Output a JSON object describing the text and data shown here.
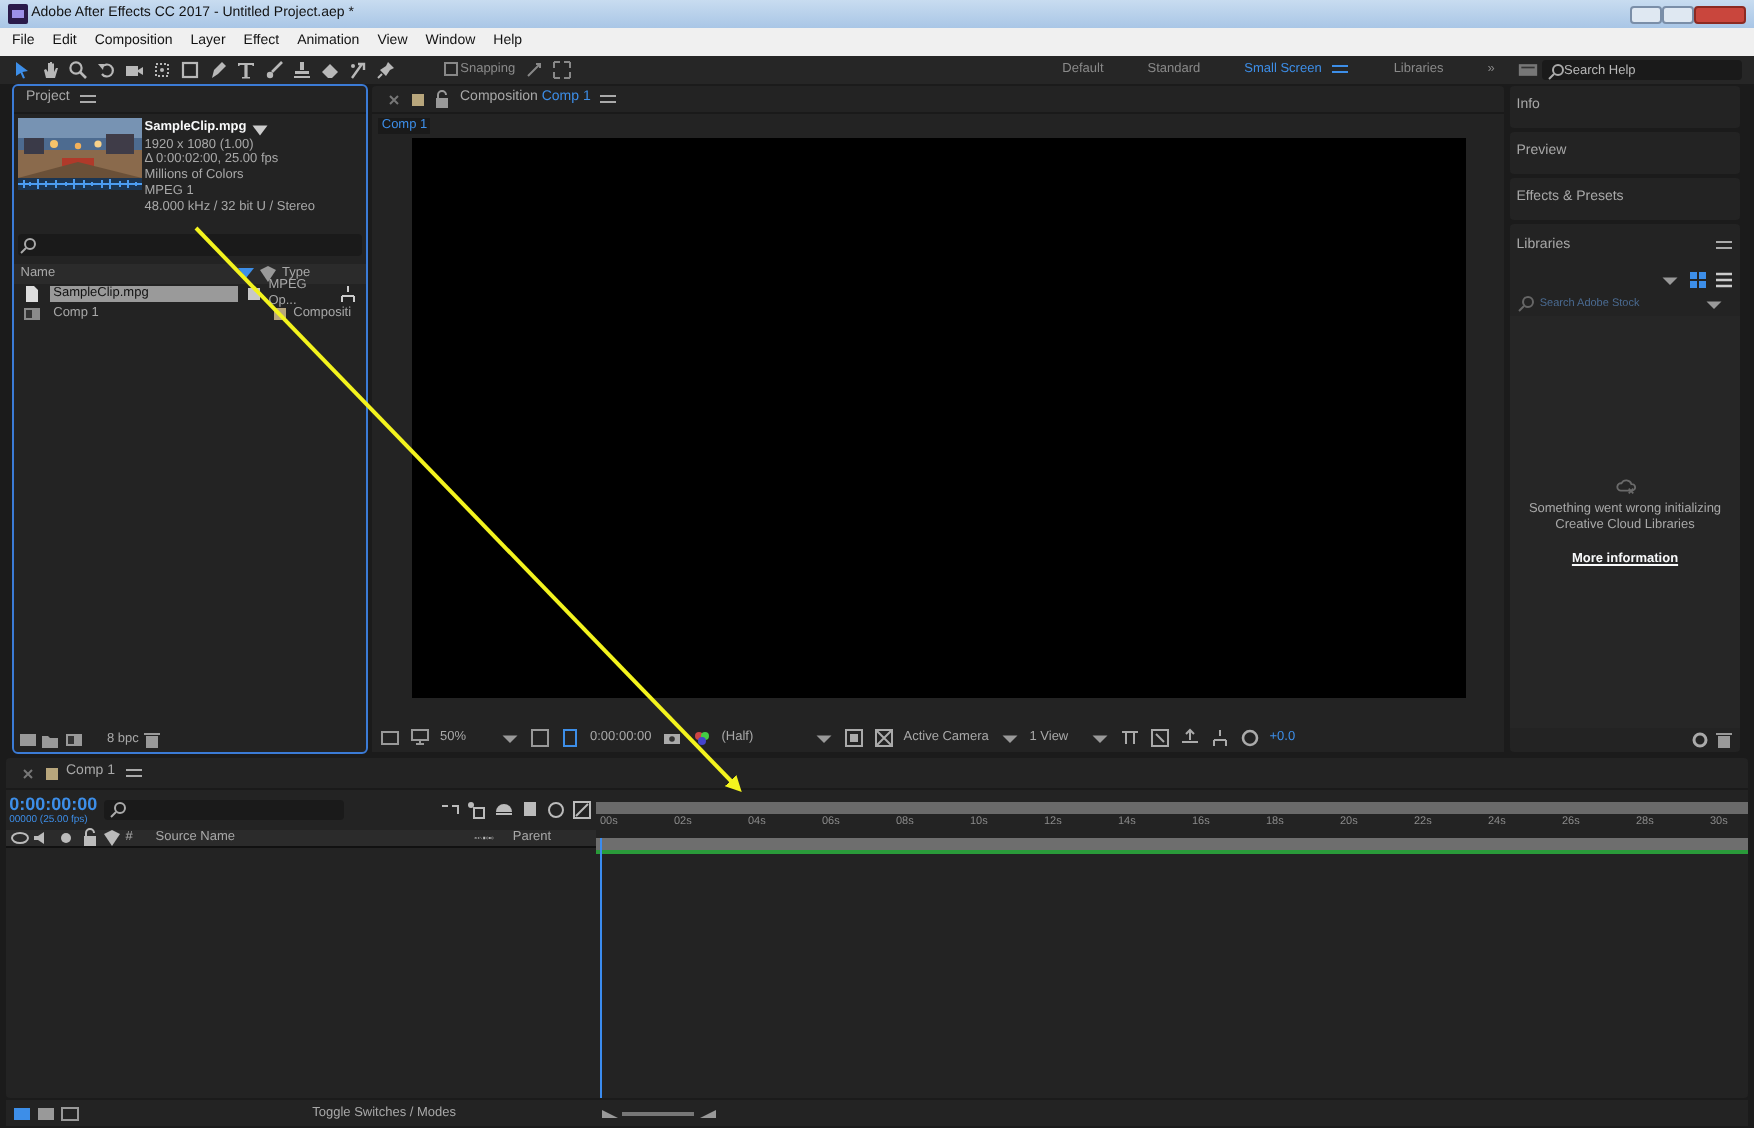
{
  "window": {
    "title": "Adobe After Effects CC 2017 - Untitled Project.aep *"
  },
  "menu": [
    "File",
    "Edit",
    "Composition",
    "Layer",
    "Effect",
    "Animation",
    "View",
    "Window",
    "Help"
  ],
  "tools": [
    {
      "kind": "select",
      "selected": true
    },
    {
      "kind": "hand",
      "selected": false
    },
    {
      "kind": "zoom",
      "selected": false
    },
    {
      "kind": "rotate",
      "selected": false
    },
    {
      "kind": "camera",
      "selected": false
    },
    {
      "kind": "pan",
      "selected": false
    },
    {
      "kind": "rect",
      "selected": false
    },
    {
      "kind": "pen",
      "selected": false
    },
    {
      "kind": "text",
      "selected": false
    },
    {
      "kind": "brush",
      "selected": false
    },
    {
      "kind": "stamp",
      "selected": false
    },
    {
      "kind": "eraser",
      "selected": false
    },
    {
      "kind": "roto",
      "selected": false
    },
    {
      "kind": "pin",
      "selected": false
    }
  ],
  "snapping": {
    "label": "Snapping",
    "checked": false
  },
  "workspaces": [
    {
      "label": "Default",
      "selected": false
    },
    {
      "label": "Standard",
      "selected": false
    },
    {
      "label": "Small Screen",
      "selected": true
    },
    {
      "label": "Libraries",
      "selected": false
    }
  ],
  "overflow": "»",
  "search_help": {
    "placeholder": "Search Help"
  },
  "project": {
    "title": "Project",
    "clip": {
      "name": "SampleClip.mpg",
      "details": [
        "1920 x 1080 (1.00)",
        "Δ 0:00:02:00, 25.00 fps",
        "Millions of Colors",
        "MPEG 1",
        "48.000 kHz / 32 bit U / Stereo"
      ]
    },
    "columns": [
      "Name",
      "Type"
    ],
    "items": [
      {
        "kind": "footage",
        "name": "SampleClip.mpg",
        "type": "MPEG Op...",
        "color": "#c8c8c8",
        "selected": true
      },
      {
        "kind": "comp",
        "name": "Comp 1",
        "type": "Compositi",
        "color": "#b8a67c",
        "selected": false
      }
    ],
    "bpc": "8 bpc"
  },
  "composition": {
    "label": "Composition",
    "name": "Comp 1",
    "tab": "Comp 1",
    "zoom": "50%",
    "timecode": "0:00:00:00",
    "resolution": "(Half)",
    "camera": "Active Camera",
    "views": "1 View",
    "exposure": "+0.0"
  },
  "side_panels": [
    "Info",
    "Preview",
    "Effects & Presets"
  ],
  "libraries": {
    "title": "Libraries",
    "placeholder": "Search Adobe Stock",
    "message": "Something went wrong initializing Creative Cloud Libraries",
    "link": "More information"
  },
  "timeline": {
    "tab": "Comp 1",
    "timecode": "0:00:00:00",
    "frames": "00000 (25.00 fps)",
    "number": "#",
    "source": "Source Name",
    "parent": "Parent",
    "ruler": [
      "00s",
      "02s",
      "04s",
      "06s",
      "08s",
      "10s",
      "12s",
      "14s",
      "16s",
      "18s",
      "20s",
      "22s",
      "24s",
      "26s",
      "28s",
      "30s"
    ],
    "toggle": "Toggle Switches / Modes"
  }
}
